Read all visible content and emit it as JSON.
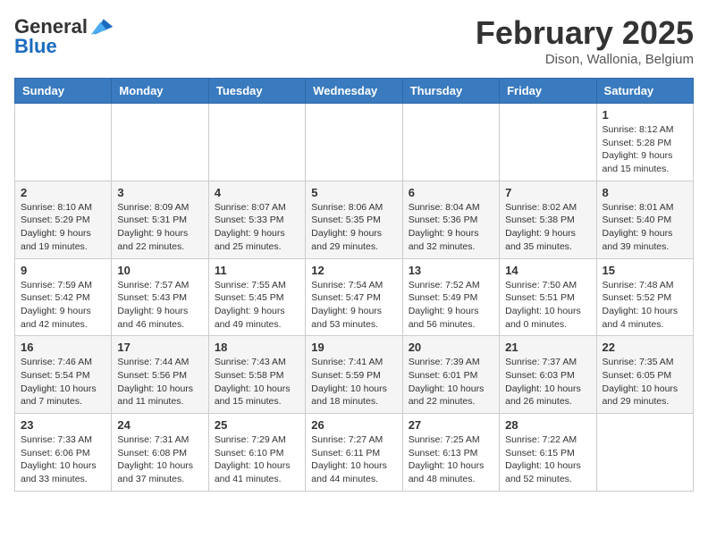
{
  "header": {
    "logo_line1": "General",
    "logo_line2": "Blue",
    "title": "February 2025",
    "subtitle": "Dison, Wallonia, Belgium"
  },
  "weekdays": [
    "Sunday",
    "Monday",
    "Tuesday",
    "Wednesday",
    "Thursday",
    "Friday",
    "Saturday"
  ],
  "weeks": [
    [
      {
        "day": "",
        "info": ""
      },
      {
        "day": "",
        "info": ""
      },
      {
        "day": "",
        "info": ""
      },
      {
        "day": "",
        "info": ""
      },
      {
        "day": "",
        "info": ""
      },
      {
        "day": "",
        "info": ""
      },
      {
        "day": "1",
        "info": "Sunrise: 8:12 AM\nSunset: 5:28 PM\nDaylight: 9 hours and 15 minutes."
      }
    ],
    [
      {
        "day": "2",
        "info": "Sunrise: 8:10 AM\nSunset: 5:29 PM\nDaylight: 9 hours and 19 minutes."
      },
      {
        "day": "3",
        "info": "Sunrise: 8:09 AM\nSunset: 5:31 PM\nDaylight: 9 hours and 22 minutes."
      },
      {
        "day": "4",
        "info": "Sunrise: 8:07 AM\nSunset: 5:33 PM\nDaylight: 9 hours and 25 minutes."
      },
      {
        "day": "5",
        "info": "Sunrise: 8:06 AM\nSunset: 5:35 PM\nDaylight: 9 hours and 29 minutes."
      },
      {
        "day": "6",
        "info": "Sunrise: 8:04 AM\nSunset: 5:36 PM\nDaylight: 9 hours and 32 minutes."
      },
      {
        "day": "7",
        "info": "Sunrise: 8:02 AM\nSunset: 5:38 PM\nDaylight: 9 hours and 35 minutes."
      },
      {
        "day": "8",
        "info": "Sunrise: 8:01 AM\nSunset: 5:40 PM\nDaylight: 9 hours and 39 minutes."
      }
    ],
    [
      {
        "day": "9",
        "info": "Sunrise: 7:59 AM\nSunset: 5:42 PM\nDaylight: 9 hours and 42 minutes."
      },
      {
        "day": "10",
        "info": "Sunrise: 7:57 AM\nSunset: 5:43 PM\nDaylight: 9 hours and 46 minutes."
      },
      {
        "day": "11",
        "info": "Sunrise: 7:55 AM\nSunset: 5:45 PM\nDaylight: 9 hours and 49 minutes."
      },
      {
        "day": "12",
        "info": "Sunrise: 7:54 AM\nSunset: 5:47 PM\nDaylight: 9 hours and 53 minutes."
      },
      {
        "day": "13",
        "info": "Sunrise: 7:52 AM\nSunset: 5:49 PM\nDaylight: 9 hours and 56 minutes."
      },
      {
        "day": "14",
        "info": "Sunrise: 7:50 AM\nSunset: 5:51 PM\nDaylight: 10 hours and 0 minutes."
      },
      {
        "day": "15",
        "info": "Sunrise: 7:48 AM\nSunset: 5:52 PM\nDaylight: 10 hours and 4 minutes."
      }
    ],
    [
      {
        "day": "16",
        "info": "Sunrise: 7:46 AM\nSunset: 5:54 PM\nDaylight: 10 hours and 7 minutes."
      },
      {
        "day": "17",
        "info": "Sunrise: 7:44 AM\nSunset: 5:56 PM\nDaylight: 10 hours and 11 minutes."
      },
      {
        "day": "18",
        "info": "Sunrise: 7:43 AM\nSunset: 5:58 PM\nDaylight: 10 hours and 15 minutes."
      },
      {
        "day": "19",
        "info": "Sunrise: 7:41 AM\nSunset: 5:59 PM\nDaylight: 10 hours and 18 minutes."
      },
      {
        "day": "20",
        "info": "Sunrise: 7:39 AM\nSunset: 6:01 PM\nDaylight: 10 hours and 22 minutes."
      },
      {
        "day": "21",
        "info": "Sunrise: 7:37 AM\nSunset: 6:03 PM\nDaylight: 10 hours and 26 minutes."
      },
      {
        "day": "22",
        "info": "Sunrise: 7:35 AM\nSunset: 6:05 PM\nDaylight: 10 hours and 29 minutes."
      }
    ],
    [
      {
        "day": "23",
        "info": "Sunrise: 7:33 AM\nSunset: 6:06 PM\nDaylight: 10 hours and 33 minutes."
      },
      {
        "day": "24",
        "info": "Sunrise: 7:31 AM\nSunset: 6:08 PM\nDaylight: 10 hours and 37 minutes."
      },
      {
        "day": "25",
        "info": "Sunrise: 7:29 AM\nSunset: 6:10 PM\nDaylight: 10 hours and 41 minutes."
      },
      {
        "day": "26",
        "info": "Sunrise: 7:27 AM\nSunset: 6:11 PM\nDaylight: 10 hours and 44 minutes."
      },
      {
        "day": "27",
        "info": "Sunrise: 7:25 AM\nSunset: 6:13 PM\nDaylight: 10 hours and 48 minutes."
      },
      {
        "day": "28",
        "info": "Sunrise: 7:22 AM\nSunset: 6:15 PM\nDaylight: 10 hours and 52 minutes."
      },
      {
        "day": "",
        "info": ""
      }
    ]
  ]
}
